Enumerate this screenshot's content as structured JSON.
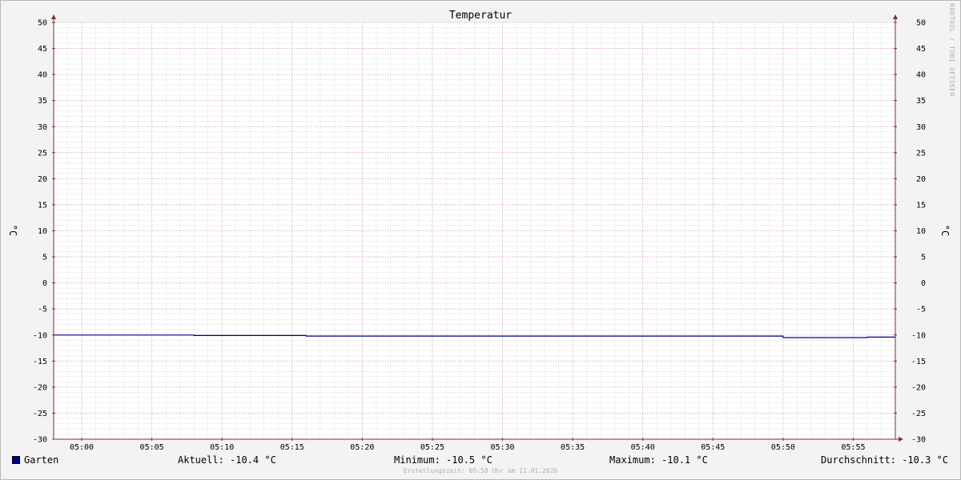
{
  "chart_data": {
    "type": "line",
    "title": "Temperatur",
    "ylabel": "°C",
    "ylabel_right": "°C",
    "ylim": [
      -30,
      50
    ],
    "y_ticks": [
      50,
      45,
      40,
      35,
      30,
      25,
      20,
      15,
      10,
      5,
      0,
      -5,
      -10,
      -15,
      -20,
      -25,
      -30
    ],
    "x_range_minutes": [
      "04:58",
      "05:58"
    ],
    "x_ticks": [
      "05:00",
      "05:05",
      "05:10",
      "05:15",
      "05:20",
      "05:25",
      "05:30",
      "05:35",
      "05:40",
      "05:45",
      "05:50",
      "05:55"
    ],
    "grid": true,
    "series": [
      {
        "name": "Garten",
        "color": "#00008b",
        "points": [
          {
            "x": "04:58",
            "y": -10.0
          },
          {
            "x": "05:08",
            "y": -10.0
          },
          {
            "x": "05:08",
            "y": -10.1
          },
          {
            "x": "05:16",
            "y": -10.1
          },
          {
            "x": "05:16",
            "y": -10.2
          },
          {
            "x": "05:50",
            "y": -10.2
          },
          {
            "x": "05:50",
            "y": -10.5
          },
          {
            "x": "05:56",
            "y": -10.5
          },
          {
            "x": "05:56",
            "y": -10.4
          },
          {
            "x": "05:58",
            "y": -10.4
          }
        ]
      }
    ]
  },
  "legend": {
    "series_name": "Garten",
    "swatch_color": "#00008b",
    "current": "Aktuell: -10.4 °C",
    "minimum": "Minimum: -10.5 °C",
    "maximum": "Maximum: -10.1 °C",
    "average": "Durchschnitt: -10.3 °C"
  },
  "footer": "Erstellungszeit: 05:58 Uhr am 11.01.2026",
  "watermark": "RRDTOOL / TOBI OETIKER",
  "colors": {
    "major_grid": "#e8a0a8",
    "minor_grid": "#c8c8c8",
    "axis": "#7a3030",
    "plot_bg": "#ffffff",
    "page_bg": "#f3f3f3"
  }
}
